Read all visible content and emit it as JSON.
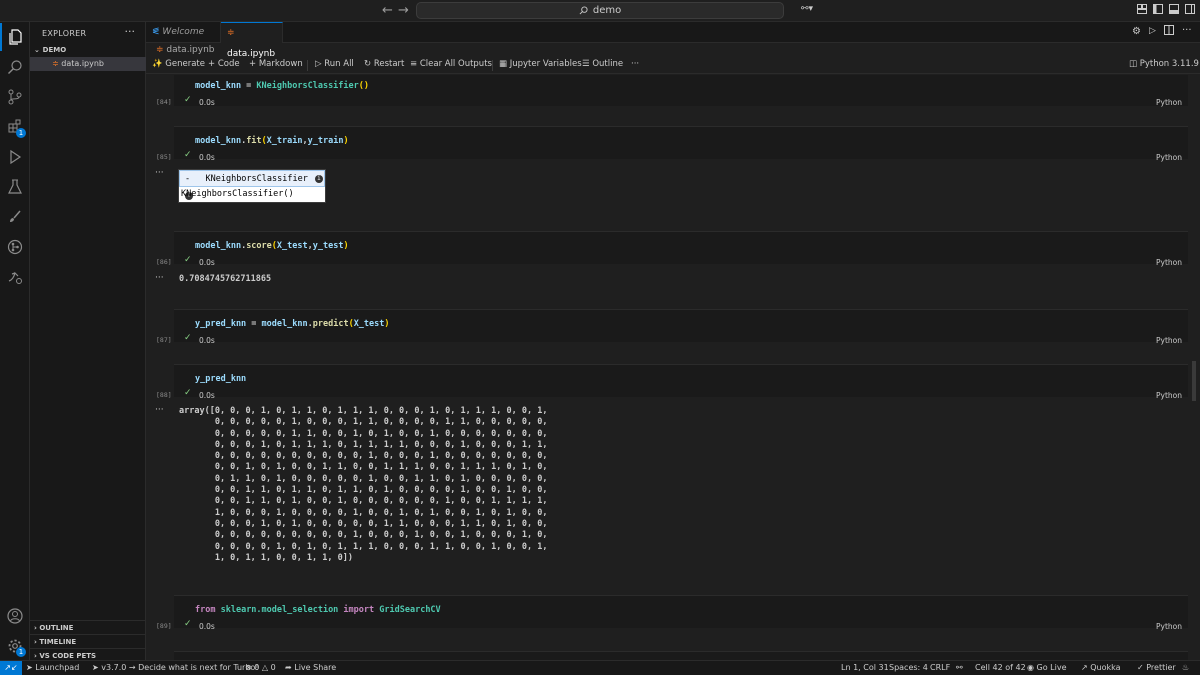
{
  "titlebar": {
    "search_text": "demo"
  },
  "explorer": {
    "title": "EXPLORER",
    "folder": "DEMO",
    "file": "data.ipynb",
    "sections": [
      "OUTLINE",
      "TIMELINE",
      "VS CODE PETS"
    ]
  },
  "activity": {
    "extensions_badge": "1",
    "settings_badge": "1"
  },
  "tabs": [
    {
      "label": "Welcome",
      "active": false
    },
    {
      "label": "data.ipynb",
      "active": true
    }
  ],
  "breadcrumb": "data.ipynb",
  "toolbar": {
    "generate": "Generate",
    "code": "Code",
    "markdown": "Markdown",
    "run_all": "Run All",
    "restart": "Restart",
    "clear_outputs": "Clear All Outputs",
    "jupyter_variables": "Jupyter Variables",
    "outline": "Outline",
    "kernel": "Python 3.11.9"
  },
  "cells": [
    {
      "count": "[84]",
      "time": "0.0s",
      "lang": "Python"
    },
    {
      "count": "[85]",
      "time": "0.0s",
      "lang": "Python"
    },
    {
      "count": "[86]",
      "time": "0.0s",
      "lang": "Python"
    },
    {
      "count": "[87]",
      "time": "0.0s",
      "lang": "Python"
    },
    {
      "count": "[88]",
      "time": "0.0s",
      "lang": "Python"
    },
    {
      "count": "[89]",
      "time": "0.0s",
      "lang": "Python"
    }
  ],
  "widget": {
    "toggle": "-",
    "title": "KNeighborsClassifier",
    "body": "KNeighborsClassifier()"
  },
  "score_output": "0.7084745762711865",
  "array_output": "array([0, 0, 0, 1, 0, 1, 1, 0, 1, 1, 1, 0, 0, 0, 1, 0, 1, 1, 1, 0, 0, 1,\n       0, 0, 0, 0, 0, 1, 0, 0, 0, 1, 1, 0, 0, 0, 0, 1, 1, 0, 0, 0, 0, 0,\n       0, 0, 0, 0, 0, 1, 1, 0, 0, 1, 0, 1, 0, 0, 1, 0, 0, 0, 0, 0, 0, 0,\n       0, 0, 0, 1, 0, 1, 1, 1, 0, 1, 1, 1, 1, 0, 0, 0, 1, 0, 0, 0, 1, 1,\n       0, 0, 0, 0, 0, 0, 0, 0, 0, 0, 1, 0, 0, 0, 1, 0, 0, 0, 0, 0, 0, 0,\n       0, 0, 1, 0, 1, 0, 0, 1, 1, 0, 0, 1, 1, 1, 0, 0, 1, 1, 1, 0, 1, 0,\n       0, 1, 1, 0, 1, 0, 0, 0, 0, 0, 1, 0, 0, 1, 1, 0, 1, 0, 0, 0, 0, 0,\n       0, 0, 1, 1, 0, 1, 1, 0, 1, 1, 0, 1, 0, 0, 0, 0, 1, 0, 0, 1, 0, 0,\n       0, 0, 1, 1, 0, 1, 0, 0, 1, 0, 0, 0, 0, 0, 0, 1, 0, 0, 1, 1, 1, 1,\n       1, 0, 0, 0, 1, 0, 0, 0, 0, 1, 0, 0, 1, 0, 1, 0, 0, 1, 0, 1, 0, 0,\n       0, 0, 0, 1, 0, 1, 0, 0, 0, 0, 0, 1, 1, 0, 0, 0, 1, 1, 0, 1, 0, 0,\n       0, 0, 0, 0, 0, 0, 0, 0, 0, 1, 0, 0, 0, 1, 0, 0, 1, 0, 0, 0, 1, 0,\n       0, 0, 0, 0, 1, 0, 1, 0, 1, 1, 1, 0, 0, 0, 1, 1, 0, 0, 1, 0, 0, 1,\n       1, 0, 1, 1, 0, 0, 1, 1, 0])",
  "code": {
    "c84": {
      "var": "model_knn",
      "eq": " = ",
      "cls": "KNeighborsClassifier",
      "open": "(",
      "close": ")"
    },
    "c85": {
      "obj": "model_knn",
      "dot": ".",
      "fn": "fit",
      "open": "(",
      "a1": "X_train",
      "comma": ",",
      "a2": "y_train",
      "close": ")"
    },
    "c86": {
      "obj": "model_knn",
      "dot": ".",
      "fn": "score",
      "open": "(",
      "a1": "X_test",
      "comma": ",",
      "a2": "y_test",
      "close": ")"
    },
    "c87": {
      "var": "y_pred_knn",
      "eq": " = ",
      "obj": "model_knn",
      "dot": ".",
      "fn": "predict",
      "open": "(",
      "a1": "X_test",
      "close": ")"
    },
    "c88": {
      "var": "y_pred_knn"
    },
    "c89": {
      "from": "from",
      "mod": " sklearn.model_selection ",
      "imp": "import",
      "name": " GridSearchCV"
    }
  },
  "statusbar": {
    "launchpad": "Launchpad",
    "turbo": "v3.7.0 → Decide what is next for Turbo!",
    "errors": "0",
    "warnings": "0",
    "liveshare": "Live Share",
    "position": "Ln 1, Col 31",
    "spaces": "Spaces: 4",
    "eol": "CRLF",
    "cell": "Cell 42 of 42",
    "golive": "Go Live",
    "quokka": "Quokka",
    "prettier": "Prettier"
  },
  "colors": {
    "accent": "#0078d4",
    "check": "#89d185",
    "function": "#dcdcaa",
    "class": "#4ec9b0",
    "variable": "#9cdcfe",
    "keyword": "#c586c0"
  }
}
